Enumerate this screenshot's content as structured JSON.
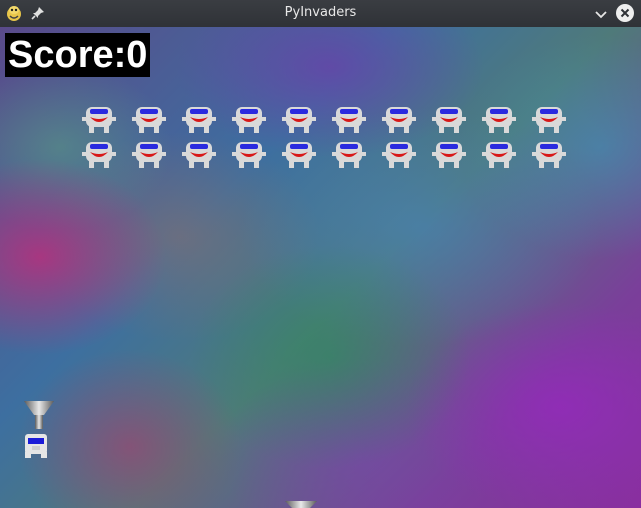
{
  "window": {
    "title": "PyInvaders",
    "icons": {
      "app": "pygame-snake-icon",
      "pin": "pin-icon",
      "minimize": "chevron-down-icon",
      "close": "close-icon"
    }
  },
  "game": {
    "score_text": "Score:0",
    "invader_rows": 2,
    "invader_columns": 10,
    "colors": {
      "invader_body": "#d9d9d9",
      "invader_eyes": "#2a2adf",
      "invader_mouth": "#d81818",
      "score_bg": "#000000",
      "score_fg": "#ffffff"
    }
  }
}
